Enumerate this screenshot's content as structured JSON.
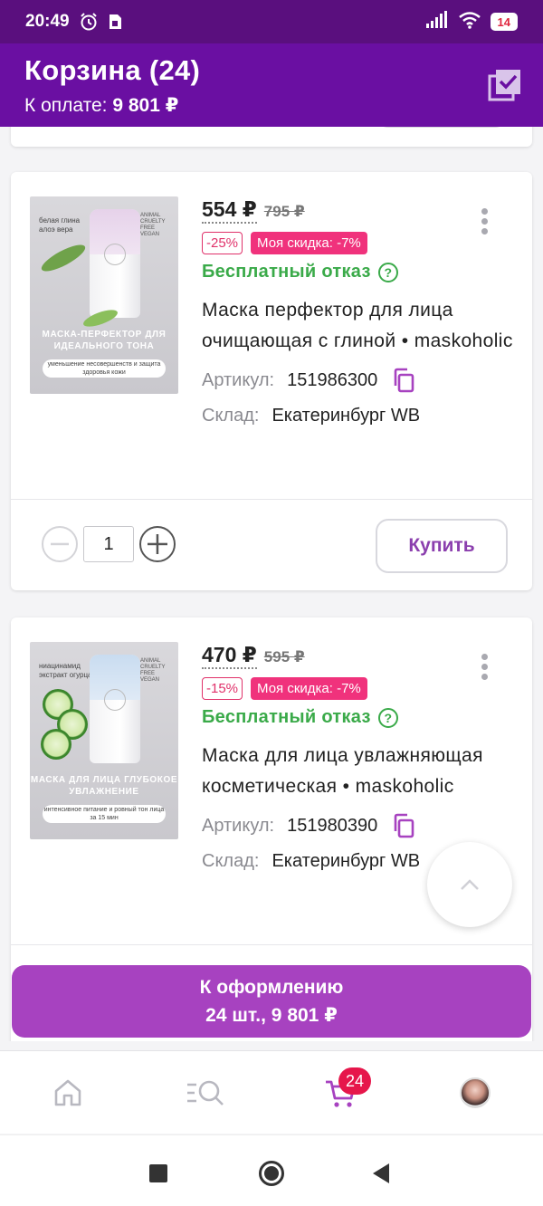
{
  "status_bar": {
    "time": "20:49",
    "battery": "14",
    "icons": [
      "alarm-icon",
      "sim-icon",
      "signal-icon",
      "wifi-icon",
      "battery-icon"
    ]
  },
  "header": {
    "title": "Корзина (24)",
    "subtitle_label": "К оплате:",
    "subtitle_value": "9 801 ₽",
    "select_all_icon": "checkbox-stack-icon"
  },
  "items": [
    {
      "price": "554 ₽",
      "old_price": "795 ₽",
      "discount": "-25%",
      "my_discount": "Моя скидка: -7%",
      "free_return": "Бесплатный отказ",
      "name": "Маска перфектор для лица очищающая с глиной • maskoholic",
      "article_label": "Артикул:",
      "article": "151986300",
      "stock_label": "Склад:",
      "stock": "Екатеринбург WB",
      "quantity": "1",
      "buy_label": "Купить",
      "image": {
        "top_text": "белая глина алоэ вера",
        "brand_tag": "ANIMAL CRUELTY FREE VEGAN",
        "banner": "МАСКА-ПЕРФЕКТОР ДЛЯ ИДЕАЛЬНОГО ТОНА",
        "pill": "уменьшение несовершенств и защита здоровья кожи",
        "cap_color": "#e6d2ea",
        "accent": "plant"
      }
    },
    {
      "price": "470 ₽",
      "old_price": "595 ₽",
      "discount": "-15%",
      "my_discount": "Моя скидка: -7%",
      "free_return": "Бесплатный отказ",
      "name": "Маска для лица увлажняющая косметическая • maskoholic",
      "article_label": "Артикул:",
      "article": "151980390",
      "stock_label": "Склад:",
      "stock": "Екатеринбург WB",
      "image": {
        "top_text": "ниацинамид экстракт огурца",
        "brand_tag": "ANIMAL CRUELTY FREE VEGAN",
        "banner": "МАСКА ДЛЯ ЛИЦА ГЛУБОКОЕ УВЛАЖНЕНИЕ",
        "pill": "интенсивное питание и ровный тон лица за 15 мин",
        "cap_color": "#c9dcf0",
        "accent": "cucumber"
      }
    }
  ],
  "checkout": {
    "label": "К оформлению",
    "summary": "24 шт., 9 801 ₽"
  },
  "bottom_nav": {
    "items": [
      "home-icon",
      "catalog-search-icon",
      "cart-icon",
      "profile-avatar"
    ],
    "cart_badge": "24"
  },
  "colors": {
    "header": "#6a0fa2",
    "status_bar": "#5a0f7e",
    "accent_purple": "#a742c0",
    "discount_pink": "#f0327c",
    "free_green": "#3aaa49",
    "badge_red": "#e6164b"
  }
}
